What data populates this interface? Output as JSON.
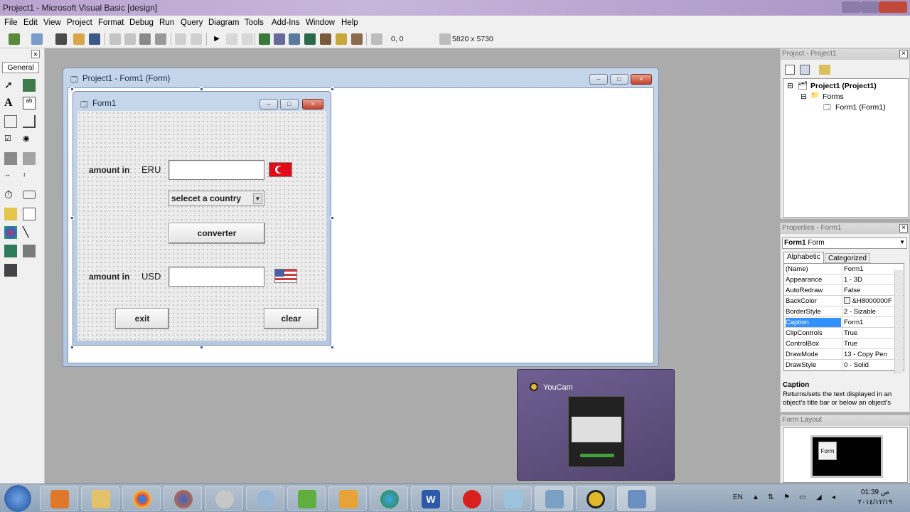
{
  "window": {
    "title": "Project1 - Microsoft Visual Basic [design]"
  },
  "menu": {
    "items": [
      "File",
      "Edit",
      "View",
      "Project",
      "Format",
      "Debug",
      "Run",
      "Query",
      "Diagram",
      "Tools",
      "Add-Ins",
      "Window",
      "Help"
    ]
  },
  "toolbar": {
    "position": "0, 0",
    "size": "5820 x 5730"
  },
  "toolbox": {
    "tab": "General"
  },
  "designer": {
    "title": "Project1 - Form1 (Form)"
  },
  "form1": {
    "title": "Form1",
    "label_amount_top": "amount in",
    "label_currency_top": "ERU",
    "combo_text": "selecet a country",
    "converter_label": "converter",
    "label_amount_bottom": "amount in",
    "label_currency_bottom": "USD",
    "exit_label": "exit",
    "clear_label": "clear"
  },
  "project_pane": {
    "title": "Project - Project1",
    "root": "Project1 (Project1)",
    "folder": "Forms",
    "item": "Form1 (Form1)"
  },
  "properties_pane": {
    "title": "Properties - Form1",
    "object": "Form1",
    "object_type": "Form",
    "tab_alpha": "Alphabetic",
    "tab_cat": "Categorized",
    "rows": [
      {
        "name": "(Name)",
        "value": "Form1"
      },
      {
        "name": "Appearance",
        "value": "1 - 3D"
      },
      {
        "name": "AutoRedraw",
        "value": "False"
      },
      {
        "name": "BackColor",
        "value": "&H8000000F"
      },
      {
        "name": "BorderStyle",
        "value": "2 - Sizable"
      },
      {
        "name": "Caption",
        "value": "Form1"
      },
      {
        "name": "ClipControls",
        "value": "True"
      },
      {
        "name": "ControlBox",
        "value": "True"
      },
      {
        "name": "DrawMode",
        "value": "13 - Copy Pen"
      },
      {
        "name": "DrawStyle",
        "value": "0 - Solid"
      }
    ],
    "desc_title": "Caption",
    "desc_text": "Returns/sets the text displayed in an object's title bar or below an object's"
  },
  "layout_pane": {
    "title": "Form Layout",
    "form_label": "Form"
  },
  "youcam": {
    "title": "YouCam"
  },
  "taskbar": {
    "lang": "EN",
    "time": "01:39 ص",
    "date": "٢٠١٤/١٢/١٩"
  }
}
